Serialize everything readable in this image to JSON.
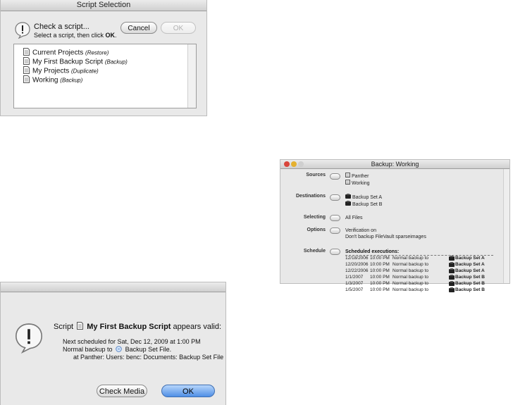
{
  "script_selection": {
    "window_title": "Script Selection",
    "heading": "Check a script...",
    "instruction_prefix": "Select a script, then click ",
    "instruction_bold": "OK",
    "instruction_suffix": ".",
    "cancel_label": "Cancel",
    "ok_label": "OK",
    "scripts": [
      {
        "name": "Current Projects",
        "mode": "(Restore)"
      },
      {
        "name": "My First Backup Script",
        "mode": "(Backup)"
      },
      {
        "name": "My Projects",
        "mode": "(Duplicate)"
      },
      {
        "name": "Working",
        "mode": "(Backup)"
      }
    ]
  },
  "backup_window": {
    "window_title": "Backup: Working",
    "sources_label": "Sources",
    "sources": [
      "Panther",
      "Working"
    ],
    "destinations_label": "Destinations",
    "destinations": [
      "Backup Set A",
      "Backup Set B"
    ],
    "selecting_label": "Selecting",
    "selecting_value": "All Files",
    "options_label": "Options",
    "options": [
      "Verification on",
      "Don't backup FileVault sparseimages"
    ],
    "schedule_label": "Schedule",
    "schedule_heading": "Scheduled executions:",
    "schedule": [
      {
        "date": "12/18/2006",
        "time": "10:00 PM",
        "desc": "Normal backup to",
        "set": "Backup Set A"
      },
      {
        "date": "12/20/2006",
        "time": "10:00 PM",
        "desc": "Normal backup to",
        "set": "Backup Set A"
      },
      {
        "date": "12/22/2006",
        "time": "10:00 PM",
        "desc": "Normal backup to",
        "set": "Backup Set A"
      },
      {
        "date": "1/1/2007",
        "time": "10:00 PM",
        "desc": "Normal backup to",
        "set": "Backup Set B"
      },
      {
        "date": "1/3/2007",
        "time": "10:00 PM",
        "desc": "Normal backup to",
        "set": "Backup Set B"
      },
      {
        "date": "1/5/2007",
        "time": "10:00 PM",
        "desc": "Normal backup to",
        "set": "Backup Set B"
      }
    ]
  },
  "validation_alert": {
    "title_prefix": "Script",
    "script_name": "My First Backup Script",
    "title_suffix": "appears valid:",
    "next_scheduled": "Next scheduled for Sat, Dec 12, 2009 at 1:00 PM",
    "normal_backup_prefix": "Normal backup to",
    "backup_set_file": "Backup Set File.",
    "location": "at Panther: Users: benc: Documents: Backup Set File",
    "check_media_label": "Check Media",
    "ok_label": "OK"
  },
  "colors": {
    "default_button": "#4f8fe6",
    "window_background": "#e9e9e9"
  }
}
